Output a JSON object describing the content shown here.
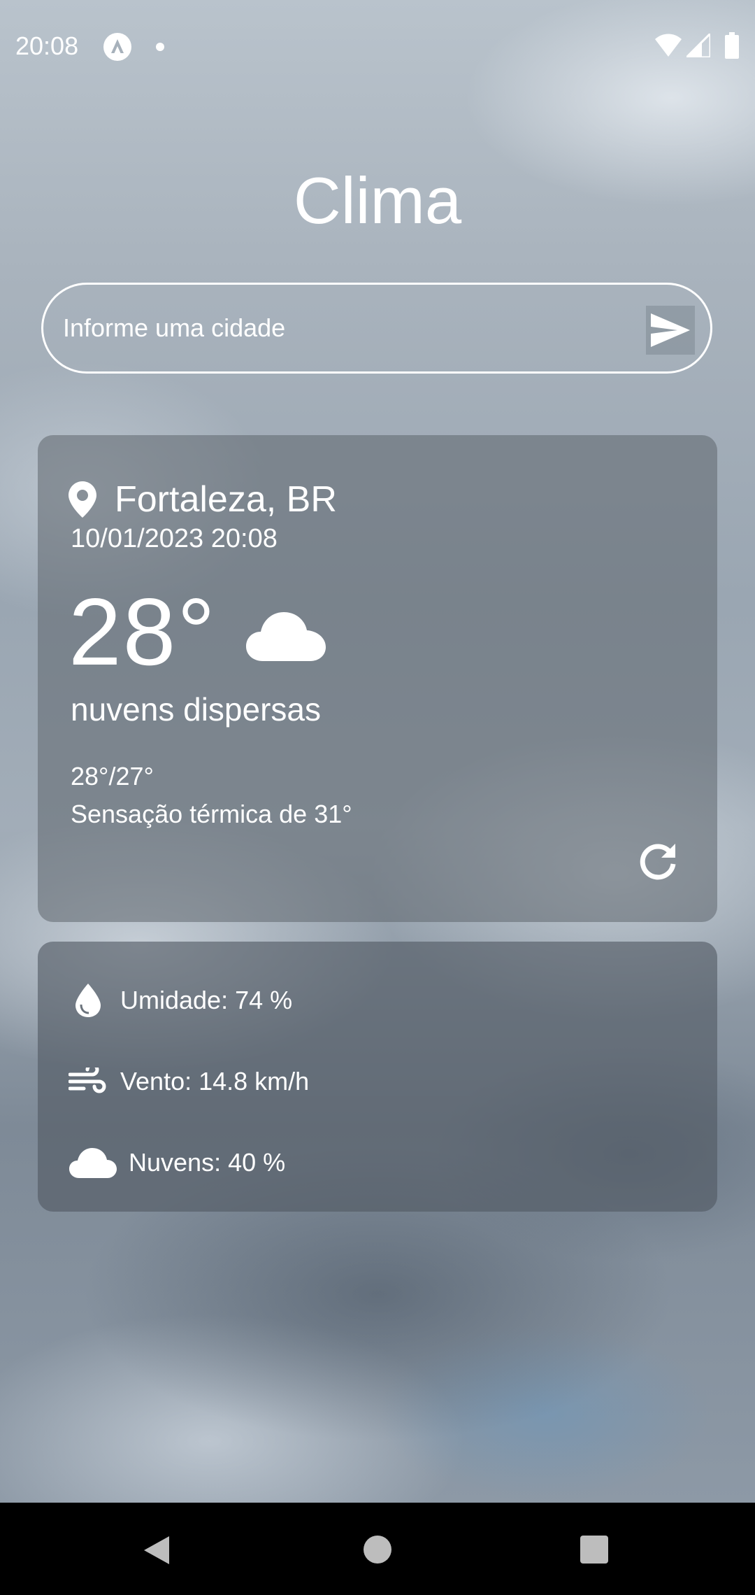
{
  "status_bar": {
    "time": "20:08"
  },
  "app": {
    "title": "Clima"
  },
  "search": {
    "placeholder": "Informe uma cidade",
    "value": ""
  },
  "current": {
    "location": "Fortaleza, BR",
    "datetime": "10/01/2023 20:08",
    "temperature": "28°",
    "description": "nuvens dispersas",
    "min_max": "28°/27°",
    "feels_like": "Sensação térmica de 31°",
    "icon": "cloud-icon"
  },
  "details": {
    "humidity": "Umidade: 74 %",
    "wind": "Vento: 14.8 km/h",
    "clouds": "Nuvens: 40 %"
  },
  "icons": {
    "location": "map-pin-icon",
    "send": "send-icon",
    "refresh": "refresh-icon",
    "humidity": "droplet-icon",
    "wind": "wind-icon",
    "clouds": "cloud-icon"
  },
  "colors": {
    "text": "#ffffff",
    "card_background": "#5f666e",
    "nav_bar": "#000000"
  }
}
